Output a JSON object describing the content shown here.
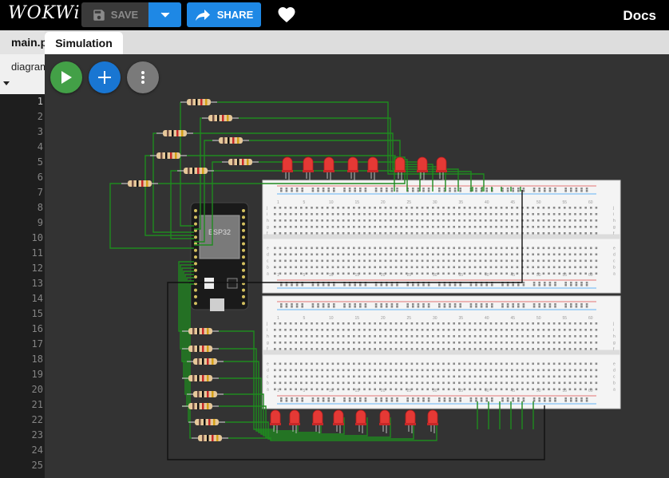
{
  "app": {
    "logo": "WOKWi"
  },
  "toolbar": {
    "save_label": "SAVE",
    "share_label": "SHARE",
    "docs_label": "Docs"
  },
  "tabs": {
    "editor_file": "main.py",
    "simulation": "Simulation",
    "diagram_tab": "diagram.json"
  },
  "editor": {
    "line_numbers": [
      "1",
      "2",
      "3",
      "4",
      "5",
      "6",
      "7",
      "8",
      "9",
      "10",
      "11",
      "12",
      "13",
      "14",
      "15",
      "16",
      "17",
      "18",
      "19",
      "20",
      "21",
      "22",
      "23",
      "24",
      "25"
    ],
    "active_line": "1"
  },
  "simulation": {
    "board_label": "ESP32",
    "breadboard_column_numbers": [
      "1",
      "5",
      "10",
      "15",
      "20",
      "25",
      "30",
      "35",
      "40",
      "45",
      "50",
      "55",
      "60"
    ],
    "breadboard_row_letters_top": [
      "j",
      "i",
      "h",
      "g",
      "f"
    ],
    "breadboard_row_letters_bottom": [
      "e",
      "d",
      "c",
      "b",
      "a"
    ],
    "led_count_top": 8,
    "led_count_bottom": 8,
    "resistor_count_top": 8,
    "resistor_count_bottom": 8
  },
  "colors": {
    "accent_blue": "#1e88e5",
    "play_green": "#43a047",
    "add_blue": "#1976d2",
    "wire_green": "#1f8a1f",
    "led_red": "#e53935",
    "breadboard": "#f4f4f4"
  },
  "icons": {
    "save": "floppy-disk-icon",
    "dropdown": "chevron-down-icon",
    "share": "share-arrow-icon",
    "favorite": "heart-icon",
    "play": "play-icon",
    "add": "plus-icon",
    "more": "more-vertical-icon"
  }
}
